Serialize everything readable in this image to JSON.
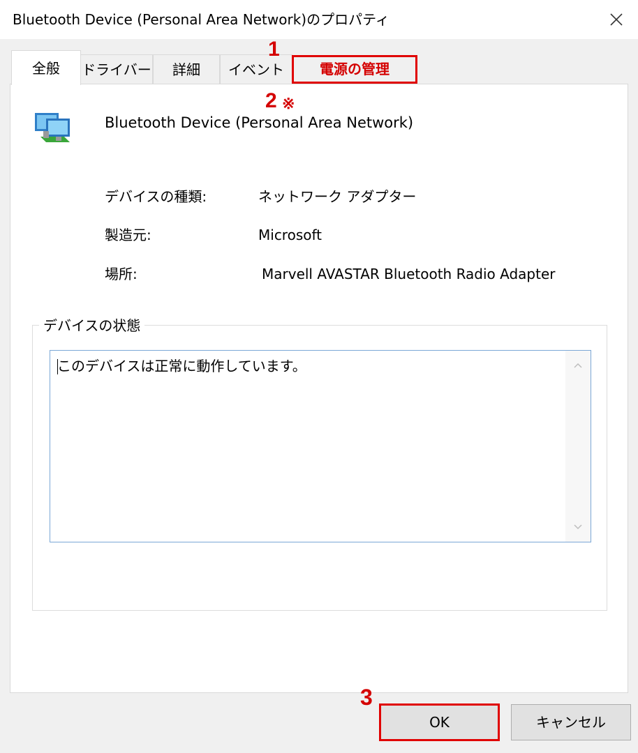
{
  "window": {
    "title": "Bluetooth Device (Personal Area Network)のプロパティ"
  },
  "tabs": [
    {
      "label": "全般",
      "active": true
    },
    {
      "label": "ドライバー",
      "active": false
    },
    {
      "label": "詳細",
      "active": false
    },
    {
      "label": "イベント",
      "active": false
    },
    {
      "label": "電源の管理",
      "active": false,
      "highlighted": true
    }
  ],
  "annotations": {
    "step1": "1",
    "step2": "2",
    "step2_mark": "※",
    "step3": "3",
    "color": "#d40000"
  },
  "device": {
    "icon": "network-adapter-icon",
    "name": "Bluetooth Device (Personal Area Network)"
  },
  "properties": [
    {
      "label": "デバイスの種類:",
      "value": "ネットワーク アダプター"
    },
    {
      "label": "製造元:",
      "value": "Microsoft"
    },
    {
      "label": "場所:",
      "value": "Marvell AVASTAR Bluetooth Radio Adapter"
    }
  ],
  "status": {
    "group_title": "デバイスの状態",
    "text": "このデバイスは正常に動作しています。"
  },
  "buttons": {
    "ok": "OK",
    "cancel": "キャンセル"
  },
  "colors": {
    "highlight": "#e00000",
    "panel": "#ffffff",
    "window_bg": "#f0f0f0",
    "textbox_border": "#7aa7d6"
  }
}
